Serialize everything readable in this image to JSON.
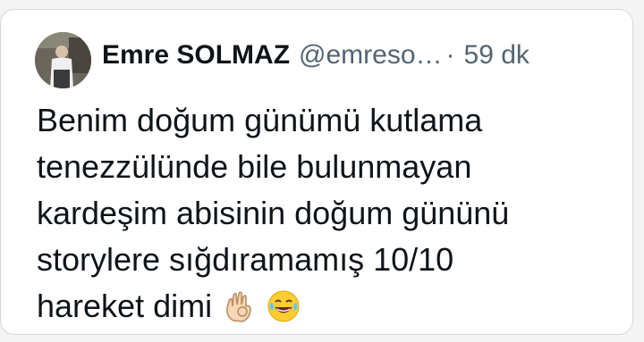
{
  "tweet": {
    "author_name": "Emre SOLMAZ",
    "handle": "@emreso…",
    "separator": "·",
    "time_ago": "59 dk",
    "lines": [
      "Benim doğum günümü kutlama",
      "tenezzülünde bile bulunmayan",
      "kardeşim abisinin doğum gününü",
      "storylere sığdıramamış 10/10",
      "hareket dimi"
    ],
    "emojis": [
      "ok-hand-emoji",
      "laughing-tears-emoji"
    ]
  }
}
